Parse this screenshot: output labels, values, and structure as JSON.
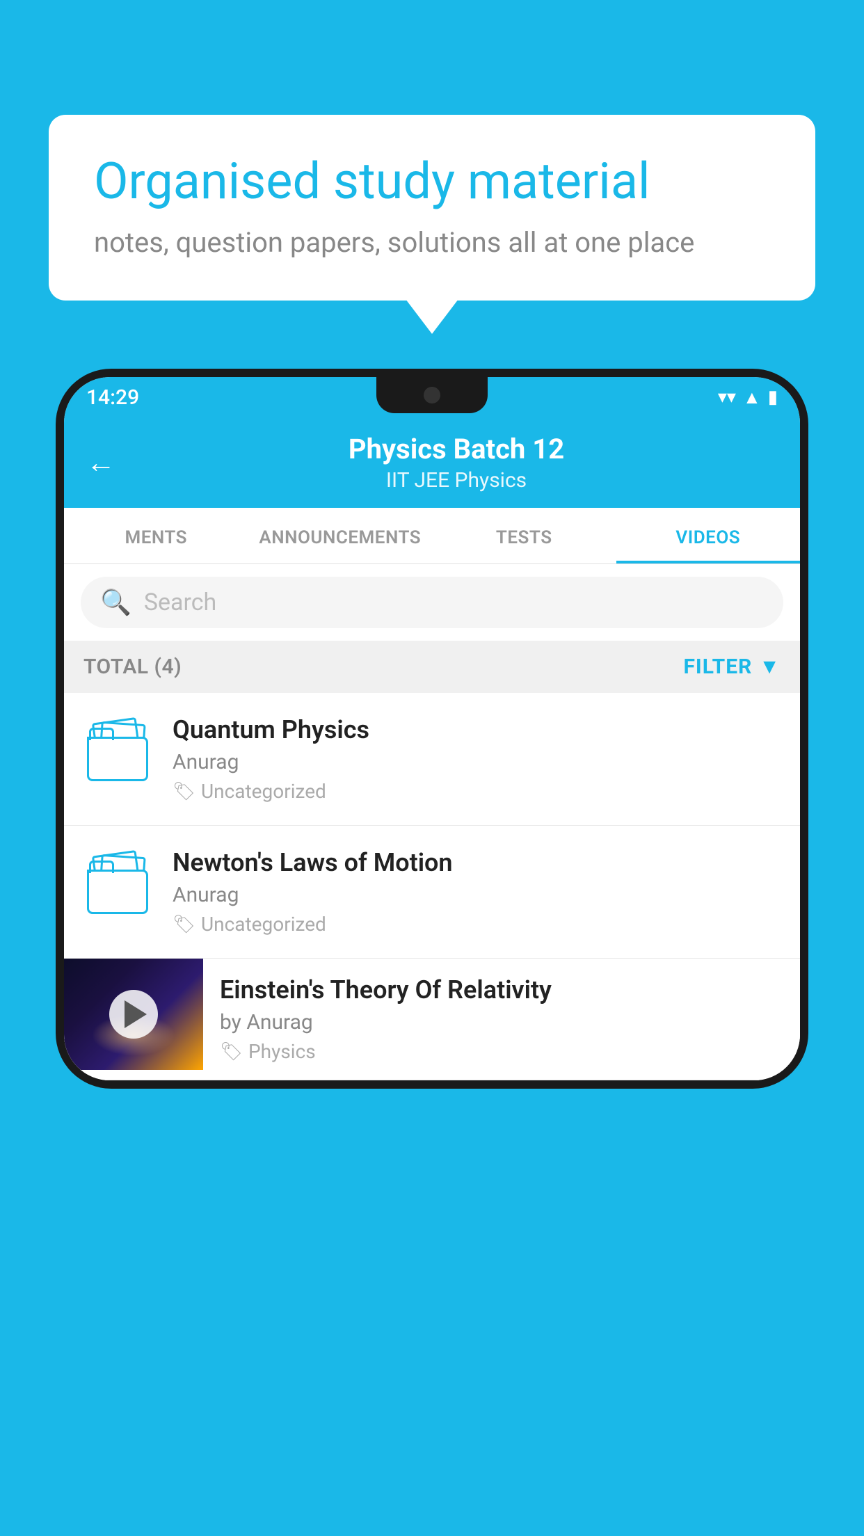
{
  "background_color": "#1ab8e8",
  "speech_bubble": {
    "heading": "Organised study material",
    "subtext": "notes, question papers, solutions all at one place"
  },
  "phone": {
    "status_bar": {
      "time": "14:29",
      "wifi_icon": "wifi",
      "signal_icon": "signal",
      "battery_icon": "battery"
    },
    "header": {
      "back_label": "←",
      "title": "Physics Batch 12",
      "subtitle": "IIT JEE   Physics"
    },
    "tabs": [
      {
        "label": "MENTS",
        "active": false
      },
      {
        "label": "ANNOUNCEMENTS",
        "active": false
      },
      {
        "label": "TESTS",
        "active": false
      },
      {
        "label": "VIDEOS",
        "active": true
      }
    ],
    "search": {
      "placeholder": "Search"
    },
    "filter_bar": {
      "total_label": "TOTAL (4)",
      "filter_label": "FILTER"
    },
    "videos": [
      {
        "id": 1,
        "title": "Quantum Physics",
        "author": "Anurag",
        "tag": "Uncategorized",
        "has_thumbnail": false
      },
      {
        "id": 2,
        "title": "Newton's Laws of Motion",
        "author": "Anurag",
        "tag": "Uncategorized",
        "has_thumbnail": false
      },
      {
        "id": 3,
        "title": "Einstein's Theory Of Relativity",
        "author": "by Anurag",
        "tag": "Physics",
        "has_thumbnail": true
      }
    ]
  }
}
